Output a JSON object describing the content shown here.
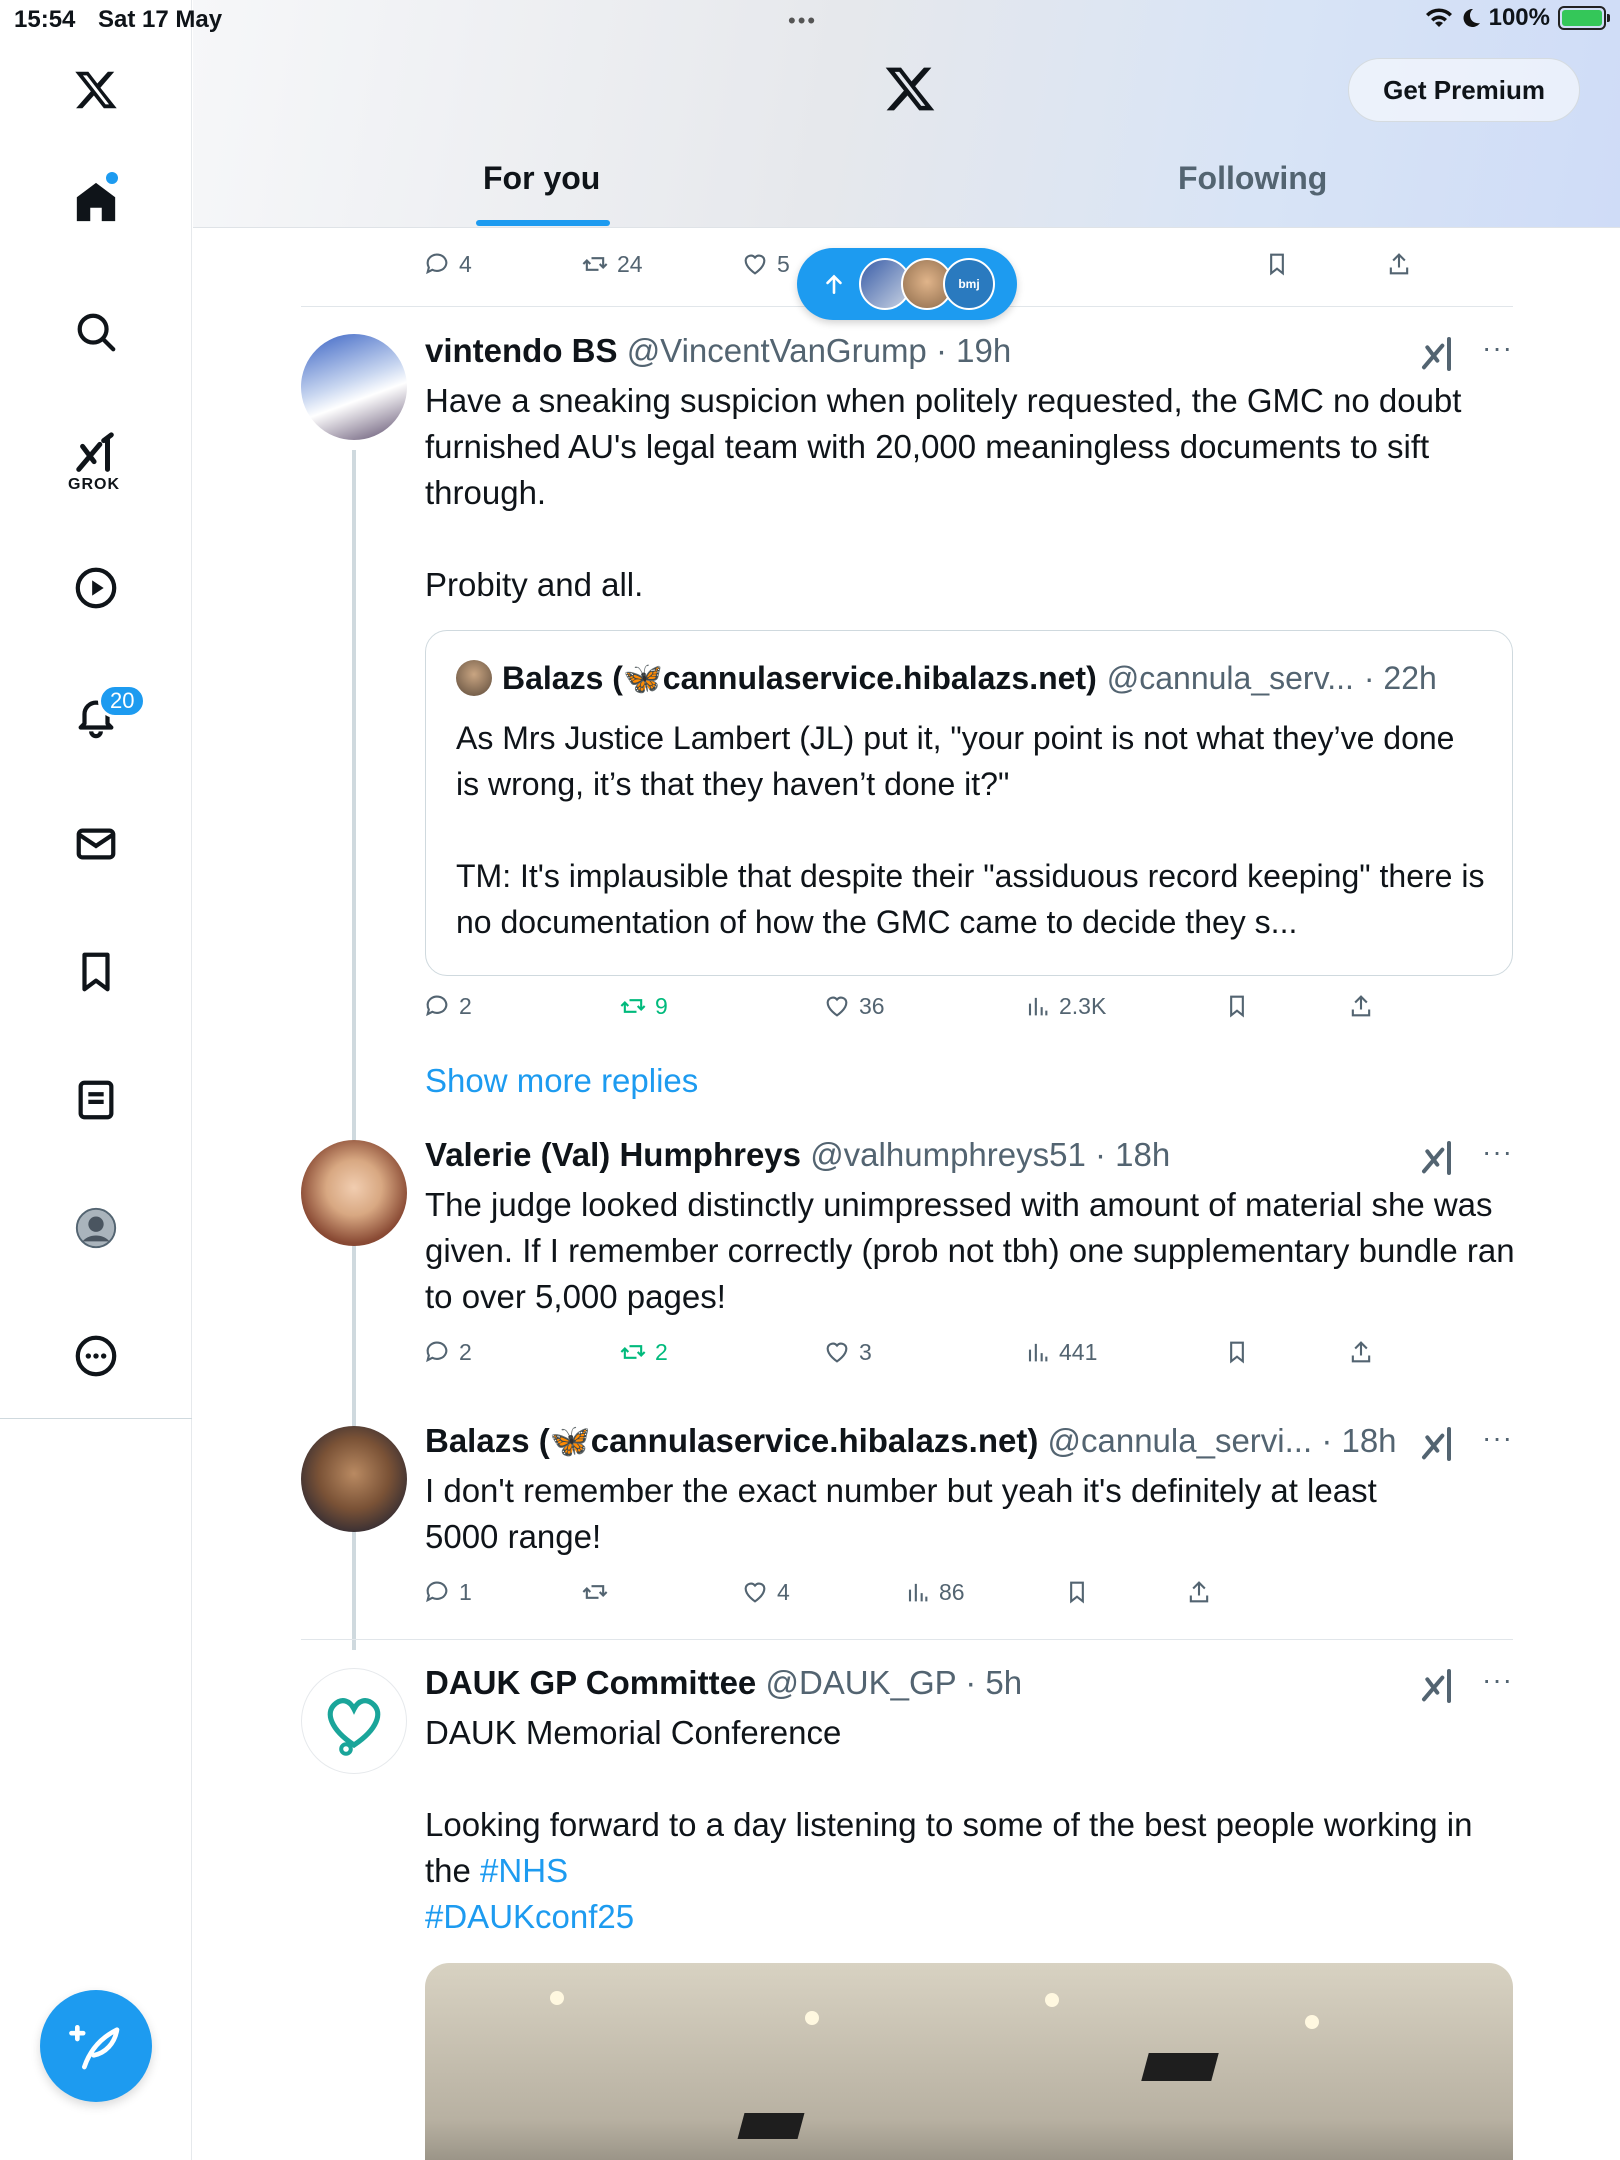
{
  "status_bar": {
    "time": "15:54",
    "date": "Sat 17 May",
    "battery": "100%"
  },
  "sidebar": {
    "grok_label": "GROK",
    "notifications_badge": "20"
  },
  "header": {
    "premium_label": "Get Premium",
    "tabs": [
      {
        "label": "For you",
        "active": true
      },
      {
        "label": "Following",
        "active": false
      }
    ]
  },
  "new_posts_pill": {
    "avatar_label": "bmj"
  },
  "top_actions": {
    "replies": "4",
    "reposts": "24",
    "likes": "5"
  },
  "tweets": [
    {
      "name": "vintendo BS",
      "handle": "@VincentVanGrump",
      "time": "· 19h",
      "text": "Have a sneaking suspicion when politely requested, the GMC no doubt furnished AU's legal team with 20,000 meaningless documents to sift through.\n\nProbity and all.",
      "quote": {
        "name": "Balazs (🦋cannulaservice.hibalazs.net)",
        "handle": "@cannula_serv...",
        "time": "· 22h",
        "text": "As Mrs Justice Lambert (JL) put it, \"your point is not what they’ve done is wrong, it’s that they haven’t done it?\"\n\nTM: It's implausible that despite their \"assiduous record keeping\" there is no documentation of how the GMC came to decide they s..."
      },
      "actions": {
        "replies": "2",
        "reposts": "9",
        "likes": "36",
        "views": "2.3K"
      }
    },
    {
      "name": "Valerie (Val) Humphreys",
      "handle": "@valhumphreys51",
      "time": "· 18h",
      "text": "The judge looked distinctly unimpressed with amount of material she was given. If I remember correctly (prob not tbh) one supplementary bundle ran to over 5,000 pages!",
      "actions": {
        "replies": "2",
        "reposts": "2",
        "likes": "3",
        "views": "441"
      }
    },
    {
      "name": "Balazs (🦋cannulaservice.hibalazs.net)",
      "handle": "@cannula_servi...",
      "time": "· 18h",
      "text": "I don't remember the exact number but yeah it's definitely at least 5000 range!",
      "actions": {
        "replies": "1",
        "reposts": "",
        "likes": "4",
        "views": "86"
      }
    },
    {
      "name": "DAUK GP Committee",
      "handle": "@DAUK_GP",
      "time": "· 5h",
      "text_main": "DAUK Memorial Conference\n\nLooking forward to a day listening to some of the best people working in the ",
      "hashtag1": "#NHS",
      "hashtag2": "#DAUKconf25"
    }
  ],
  "show_more_replies": "Show more replies",
  "colors": {
    "accent": "#1d9bf0",
    "repost_active": "#00ba7c",
    "muted": "#536471"
  }
}
